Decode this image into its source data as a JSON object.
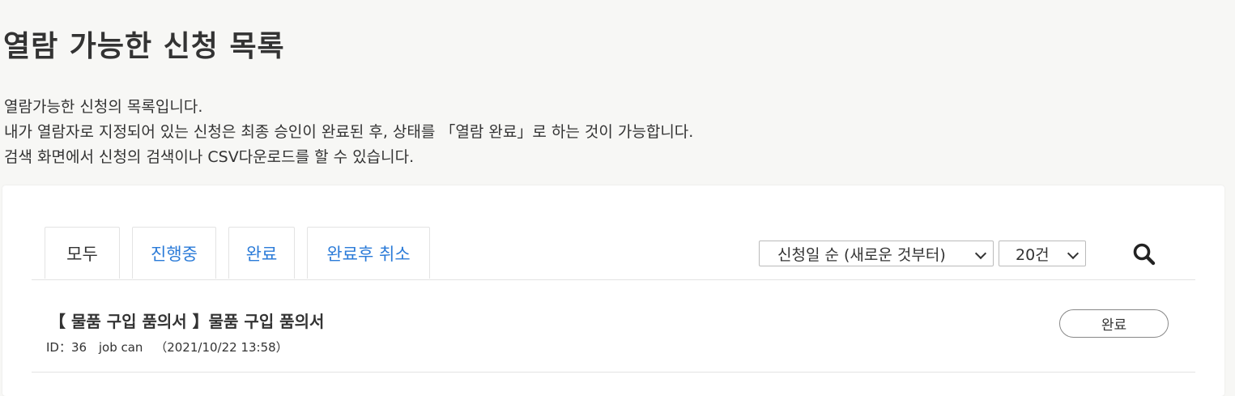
{
  "page": {
    "title": "열람 가능한 신청 목록",
    "description": [
      "열람가능한 신청의 목록입니다.",
      "내가 열람자로 지정되어 있는 신청은 최종 승인이 완료된 후, 상태를 「열람 완료」로 하는 것이 가능합니다.",
      "검색 화면에서 신청의 검색이나 CSV다운로드를 할 수 있습니다."
    ]
  },
  "tabs": [
    {
      "label": "모두",
      "active": true
    },
    {
      "label": "진행중",
      "active": false
    },
    {
      "label": "완료",
      "active": false
    },
    {
      "label": "완료후 취소",
      "active": false
    }
  ],
  "controls": {
    "sort_value": "신청일 순 (새로운 것부터)",
    "count_value": "20건",
    "search_icon": "search-icon"
  },
  "items": [
    {
      "title": "【 물품 구입 품의서 】물품 구입 품의서",
      "id": "ID：36",
      "applicant": "job can",
      "date": "（2021/10/22 13:58）",
      "status": "완료"
    }
  ],
  "colors": {
    "background": "#f7f7f5",
    "link": "#2b7bd8",
    "text": "#333333"
  }
}
